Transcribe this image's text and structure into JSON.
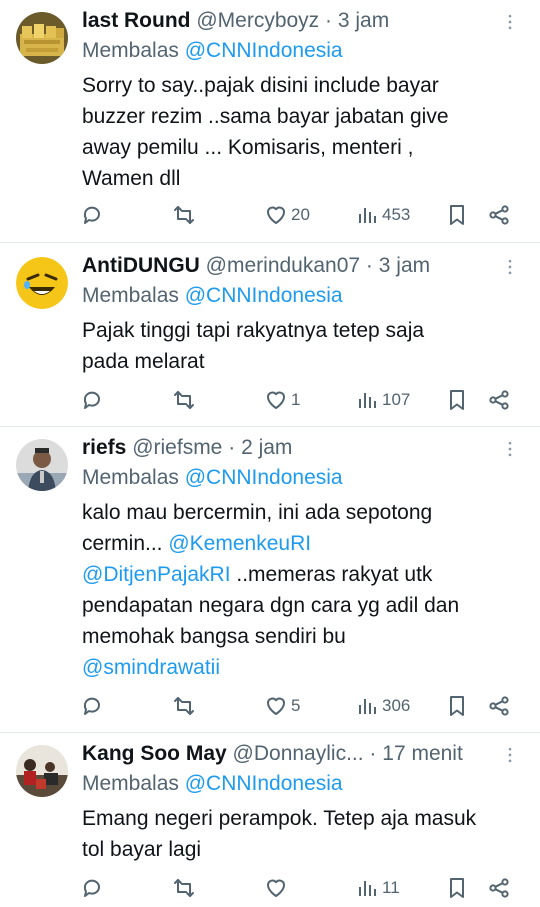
{
  "colors": {
    "accent": "#1d9bf0",
    "muted": "#536471",
    "text": "#0f1419"
  },
  "tweets": [
    {
      "name": "last Round",
      "handle": "@Mercyboyz",
      "time": "3 jam",
      "reply_prefix": "Membalas",
      "reply_to": "@CNNIndonesia",
      "lines": [
        {
          "segments": [
            {
              "t": "Sorry to say..pajak disini include bayar",
              "m": false
            }
          ]
        },
        {
          "segments": [
            {
              "t": "buzzer rezim ..sama bayar jabatan give",
              "m": false
            }
          ]
        },
        {
          "segments": [
            {
              "t": "away pemilu ... Komisaris, menteri ,",
              "m": false
            }
          ]
        },
        {
          "segments": [
            {
              "t": "Wamen dll",
              "m": false
            }
          ]
        }
      ],
      "likes": "20",
      "views": "453",
      "avatar": "gold-bars-avatar"
    },
    {
      "name": "AntiDUNGU",
      "handle": "@merindukan07",
      "time": "3 jam",
      "reply_prefix": "Membalas",
      "reply_to": "@CNNIndonesia",
      "lines": [
        {
          "segments": [
            {
              "t": "Pajak tinggi tapi rakyatnya tetep saja",
              "m": false
            }
          ]
        },
        {
          "segments": [
            {
              "t": "pada melarat",
              "m": false
            }
          ]
        }
      ],
      "likes": "1",
      "views": "107",
      "avatar": "laughing-emoji-avatar"
    },
    {
      "name": "riefs",
      "handle": "@riefsme",
      "time": "2 jam",
      "reply_prefix": "Membalas",
      "reply_to": "@CNNIndonesia",
      "lines": [
        {
          "segments": [
            {
              "t": "kalo mau bercermin, ini ada sepotong",
              "m": false
            }
          ]
        },
        {
          "segments": [
            {
              "t": "cermin... ",
              "m": false
            },
            {
              "t": "@KemenkeuRI",
              "m": true
            }
          ]
        },
        {
          "segments": [
            {
              "t": "@DitjenPajakRI",
              "m": true
            },
            {
              "t": " ..memeras rakyat utk",
              "m": false
            }
          ]
        },
        {
          "segments": [
            {
              "t": "pendapatan negara dgn cara yg adil dan",
              "m": false
            }
          ]
        },
        {
          "segments": [
            {
              "t": "memohak bangsa sendiri bu",
              "m": false
            }
          ]
        },
        {
          "segments": [
            {
              "t": "@smindrawatii",
              "m": true
            }
          ]
        }
      ],
      "likes": "5",
      "views": "306",
      "avatar": "man-photo-avatar"
    },
    {
      "name": "Kang Soo May",
      "handle": "@Donnaylic...",
      "time": "17 menit",
      "reply_prefix": "Membalas",
      "reply_to": "@CNNIndonesia",
      "lines": [
        {
          "segments": [
            {
              "t": "Emang negeri perampok. Tetep aja masuk",
              "m": false
            }
          ]
        },
        {
          "segments": [
            {
              "t": "tol bayar lagi",
              "m": false
            }
          ]
        }
      ],
      "likes": "",
      "views": "11",
      "avatar": "crowd-photo-avatar"
    }
  ]
}
